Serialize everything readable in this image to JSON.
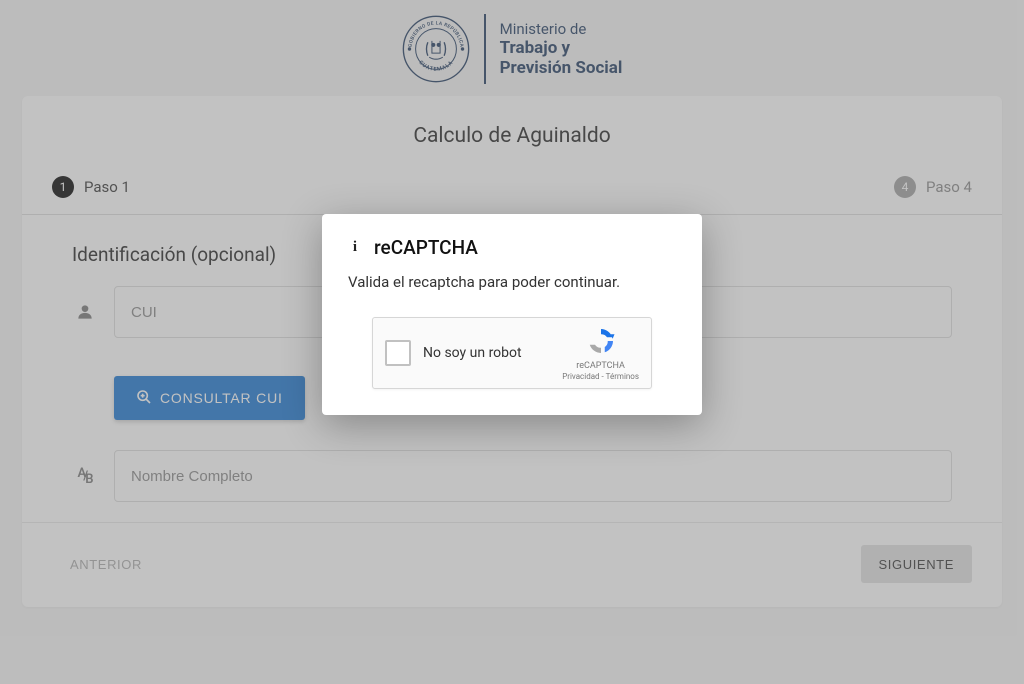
{
  "header": {
    "ministry_line1": "Ministerio de",
    "ministry_line2": "Trabajo y",
    "ministry_line3": "Previsión Social",
    "seal_top": "GOBIERNO DE LA REPÚBLICA",
    "seal_bottom": "GUATEMALA"
  },
  "page": {
    "title": "Calculo de Aguinaldo"
  },
  "stepper": {
    "step1_num": "1",
    "step1_label": "Paso 1",
    "step4_num": "4",
    "step4_label": "Paso 4"
  },
  "form": {
    "section_title": "Identificación (opcional)",
    "cui_placeholder": "CUI",
    "consult_label": "CONSULTAR CUI",
    "name_placeholder": "Nombre Completo"
  },
  "nav": {
    "prev": "ANTERIOR",
    "next": "SIGUIENTE"
  },
  "modal": {
    "title": "reCAPTCHA",
    "message": "Valida el recaptcha para poder continuar.",
    "checkbox_label": "No soy un robot",
    "brand": "reCAPTCHA",
    "links": "Privacidad - Términos"
  }
}
